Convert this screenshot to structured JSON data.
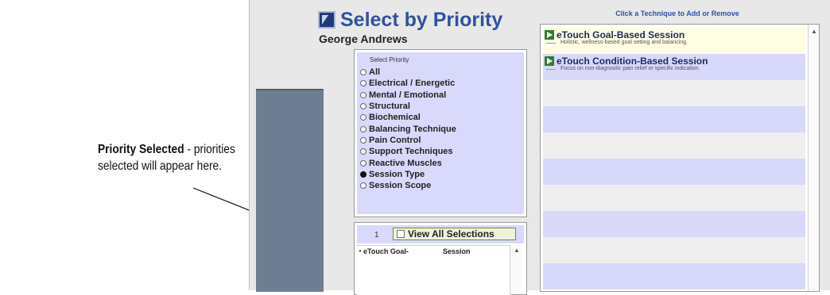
{
  "annotation": {
    "title": "Priority Selected",
    "text": " - priorities selected will appear here."
  },
  "app": {
    "title": "Select by Priority",
    "client_name": "George Andrews"
  },
  "priority_panel": {
    "header": "Select Priority",
    "items": [
      {
        "label": "All",
        "selected": false
      },
      {
        "label": "Electrical / Energetic",
        "selected": false
      },
      {
        "label": "Mental / Emotional",
        "selected": false
      },
      {
        "label": "Structural",
        "selected": false
      },
      {
        "label": "Biochemical",
        "selected": false
      },
      {
        "label": "Balancing Technique",
        "selected": false
      },
      {
        "label": "Pain Control",
        "selected": false
      },
      {
        "label": "Support Techniques",
        "selected": false
      },
      {
        "label": "Reactive Muscles",
        "selected": false
      },
      {
        "label": "Session Type",
        "selected": true
      },
      {
        "label": "Session Scope",
        "selected": false
      }
    ]
  },
  "selected_panel": {
    "count": "1",
    "view_all_label": "View All Selections",
    "rows": [
      {
        "name": "eTouch Goal-",
        "type": "Session"
      }
    ]
  },
  "techniques": {
    "header": "Click a Technique to Add or Remove",
    "items": [
      {
        "title": "eTouch Goal-Based Session",
        "desc": "Holistic, wellness-based goal setting and balancing."
      },
      {
        "title": "eTouch Condition-Based Session",
        "desc": "Focus on non-diagnostic pain relief or specific indication."
      }
    ]
  }
}
